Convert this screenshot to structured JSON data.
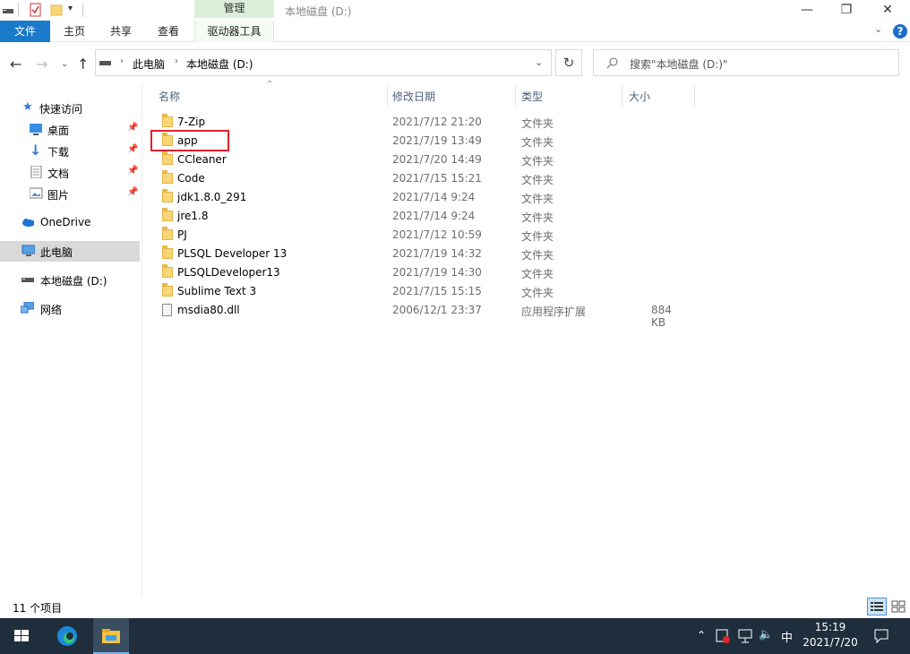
{
  "window": {
    "title": "本地磁盘 (D:)",
    "context_tab": "管理",
    "caption": {
      "minimize": "—",
      "maximize": "❐",
      "close": "✕"
    }
  },
  "ribbon": {
    "tabs": [
      "文件",
      "主页",
      "共享",
      "查看",
      "驱动器工具"
    ],
    "help": "?"
  },
  "address": {
    "crumbs": [
      "此电脑",
      "本地磁盘 (D:)"
    ],
    "search_placeholder": "搜索\"本地磁盘 (D:)\""
  },
  "nav": {
    "quick_access": "快速访问",
    "pinned": [
      "桌面",
      "下载",
      "文档",
      "图片"
    ],
    "onedrive": "OneDrive",
    "this_pc": "此电脑",
    "local_disk": "本地磁盘 (D:)",
    "network": "网络"
  },
  "columns": {
    "name": "名称",
    "date": "修改日期",
    "type": "类型",
    "size": "大小"
  },
  "files": [
    {
      "name": "7-Zip",
      "date": "2021/7/12 21:20",
      "type": "文件夹",
      "size": "",
      "kind": "folder"
    },
    {
      "name": "app",
      "date": "2021/7/19 13:49",
      "type": "文件夹",
      "size": "",
      "kind": "folder"
    },
    {
      "name": "CCleaner",
      "date": "2021/7/20 14:49",
      "type": "文件夹",
      "size": "",
      "kind": "folder"
    },
    {
      "name": "Code",
      "date": "2021/7/15 15:21",
      "type": "文件夹",
      "size": "",
      "kind": "folder"
    },
    {
      "name": "jdk1.8.0_291",
      "date": "2021/7/14 9:24",
      "type": "文件夹",
      "size": "",
      "kind": "folder"
    },
    {
      "name": "jre1.8",
      "date": "2021/7/14 9:24",
      "type": "文件夹",
      "size": "",
      "kind": "folder"
    },
    {
      "name": "PJ",
      "date": "2021/7/12 10:59",
      "type": "文件夹",
      "size": "",
      "kind": "folder"
    },
    {
      "name": "PLSQL Developer 13",
      "date": "2021/7/19 14:32",
      "type": "文件夹",
      "size": "",
      "kind": "folder"
    },
    {
      "name": "PLSQLDeveloper13",
      "date": "2021/7/19 14:30",
      "type": "文件夹",
      "size": "",
      "kind": "folder"
    },
    {
      "name": "Sublime Text 3",
      "date": "2021/7/15 15:15",
      "type": "文件夹",
      "size": "",
      "kind": "folder"
    },
    {
      "name": "msdia80.dll",
      "date": "2006/12/1 23:37",
      "type": "应用程序扩展",
      "size": "884 KB",
      "kind": "dll"
    }
  ],
  "status": {
    "count": "11 个项目"
  },
  "taskbar": {
    "time": "15:19",
    "date": "2021/7/20",
    "ime": "中"
  },
  "colors": {
    "accent": "#1979ca",
    "taskbar": "#1f2e3d",
    "highlight": "#e0222a",
    "folder": "#f9d575"
  }
}
